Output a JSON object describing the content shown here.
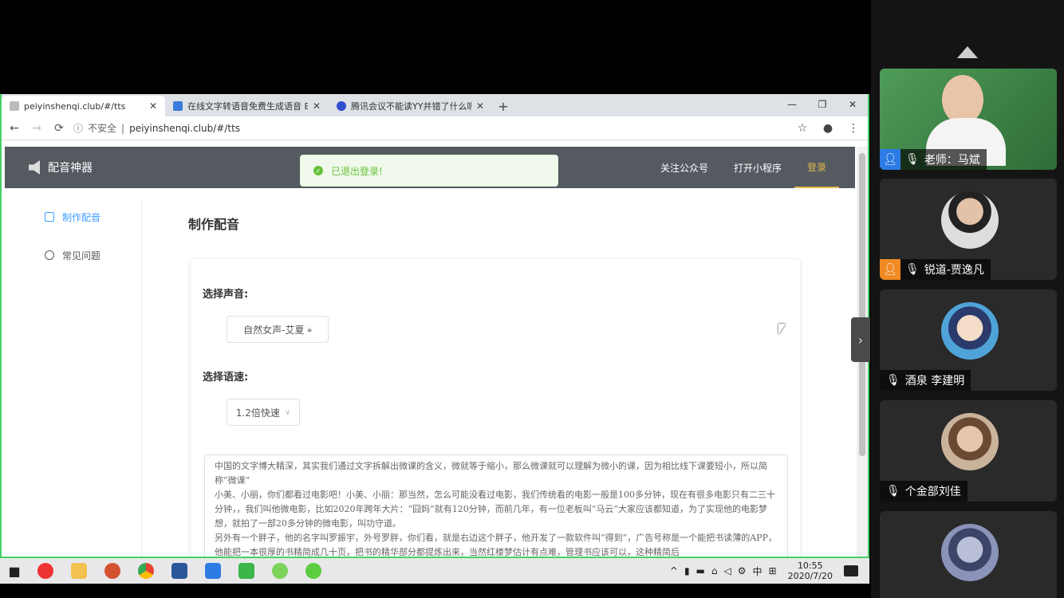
{
  "browser": {
    "tabs": [
      {
        "title": "peiyinshenqi.club/#/tts",
        "active": true
      },
      {
        "title": "在线文字转语音免费生成语音 E",
        "active": false
      },
      {
        "title": "腾讯会议不能读YY并错了什么呢",
        "active": false
      }
    ],
    "new_tab": "+",
    "win_controls": [
      "—",
      "❐",
      "✕"
    ],
    "address": {
      "security": "不安全",
      "url": "peiyinshenqi.club/#/tts"
    }
  },
  "site": {
    "logo_text": "配音神器",
    "toast": "已退出登录!",
    "nav": [
      "关注公众号",
      "打开小程序",
      "登录"
    ],
    "sidebar": [
      {
        "label": "制作配音",
        "active": true
      },
      {
        "label": "常见问题",
        "active": false
      }
    ],
    "main_title": "制作配音",
    "voice_label": "选择声音:",
    "voice_value": "自然女声-艾夏",
    "speed_label": "选择语速:",
    "speed_value": "1.2倍快速",
    "text_content": "中国的文字博大精深，其实我们通过文字拆解出微课的含义，微就等于缩小，那么微课就可以理解为微小的课，因为相比线下课要短小，所以简称“微课”\n小美、小丽，你们都看过电影吧！小美、小丽：那当然，怎么可能没看过电影，我们传统看的电影一般是100多分钟，现在有很多电影只有二三十分钟，，我们叫他微电影，比如2020年跨年大片：“囧妈”就有120分钟，而前几年，有一位老板叫“马云”大家应该都知道，为了实现他的电影梦想，就拍了一部20多分钟的微电影，叫功守道。\n另外有一个胖子，他的名字叫罗振宇，外号罗胖，你们看，就是右边这个胖子，他开发了一款软件叫“得到”，广告号称是一个能把书读薄的APP，他能把一本很厚的书精简成几十页，把书的精华部分都提炼出来，当然红楼梦估计有点难，管理书应该可以，这种精简后"
  },
  "taskbar": {
    "clock_time": "10:55",
    "clock_date": "2020/7/20",
    "ime": "中"
  },
  "participants": [
    {
      "name": "老师：马斌",
      "role_icon": "person-icon",
      "tag_color": "#2d7be5",
      "muted": false
    },
    {
      "name": "锐道-贾逸凡",
      "role_icon": "person-icon",
      "tag_color": "#f08a24",
      "muted": true
    },
    {
      "name": "酒泉 李建明",
      "muted": true
    },
    {
      "name": "个金部刘佳",
      "muted": true
    },
    {
      "name": "",
      "muted": true
    }
  ]
}
